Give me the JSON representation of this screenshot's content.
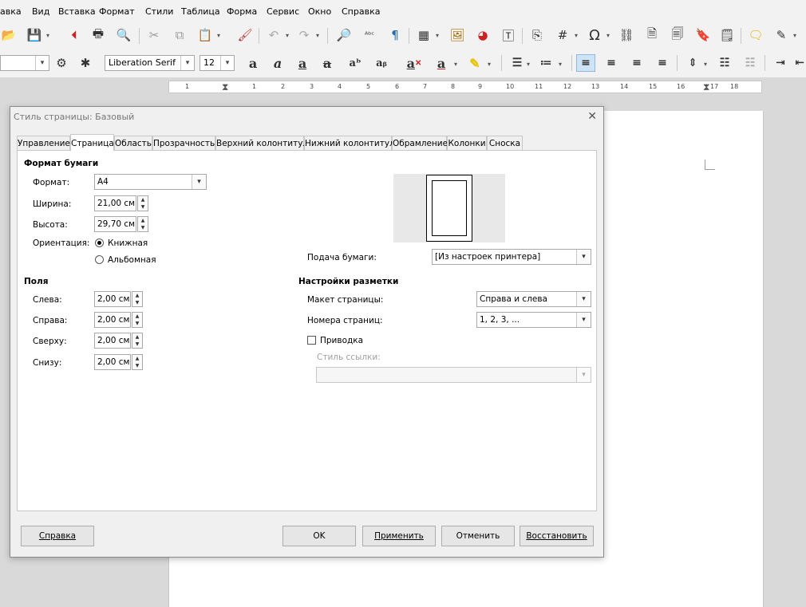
{
  "menu": [
    "авка",
    "Вид",
    "Вставка",
    "Формат",
    "Стили",
    "Таблица",
    "Форма",
    "Сервис",
    "Окно",
    "Справка"
  ],
  "toolbar2": {
    "font_name": "Liberation Serif",
    "font_size": "12"
  },
  "ruler": [
    "1",
    "1",
    "2",
    "3",
    "4",
    "5",
    "6",
    "7",
    "8",
    "9",
    "10",
    "11",
    "12",
    "13",
    "14",
    "15",
    "16",
    "17",
    "18"
  ],
  "dialog": {
    "title": "Стиль страницы: Базовый",
    "close": "✕",
    "tabs": [
      "Управление",
      "Страница",
      "Область",
      "Прозрачность",
      "Верхний колонтитул",
      "Нижний колонтитул",
      "Обрамление",
      "Колонки",
      "Сноска"
    ],
    "paper": {
      "heading": "Формат бумаги",
      "format_label": "Формат:",
      "format_value": "A4",
      "width_label": "Ширина:",
      "width_value": "21,00 см",
      "height_label": "Высота:",
      "height_value": "29,70 см",
      "orientation_label": "Ориентация:",
      "portrait": "Книжная",
      "landscape": "Альбомная",
      "tray_label": "Подача бумаги:",
      "tray_value": "[Из настроек принтера]"
    },
    "margins": {
      "heading": "Поля",
      "left_label": "Слева:",
      "left_value": "2,00 см",
      "right_label": "Справа:",
      "right_value": "2,00 см",
      "top_label": "Сверху:",
      "top_value": "2,00 см",
      "bottom_label": "Снизу:",
      "bottom_value": "2,00 см"
    },
    "layout": {
      "heading": "Настройки разметки",
      "page_layout_label": "Макет страницы:",
      "page_layout_value": "Справа и слева",
      "numbers_label": "Номера страниц:",
      "numbers_value": "1, 2, 3, ...",
      "register_label": "Приводка",
      "ref_style_label": "Стиль ссылки:",
      "ref_style_value": ""
    },
    "buttons": {
      "help": "Справка",
      "ok": "OK",
      "apply": "Применить",
      "cancel": "Отменить",
      "reset": "Восстановить"
    }
  }
}
